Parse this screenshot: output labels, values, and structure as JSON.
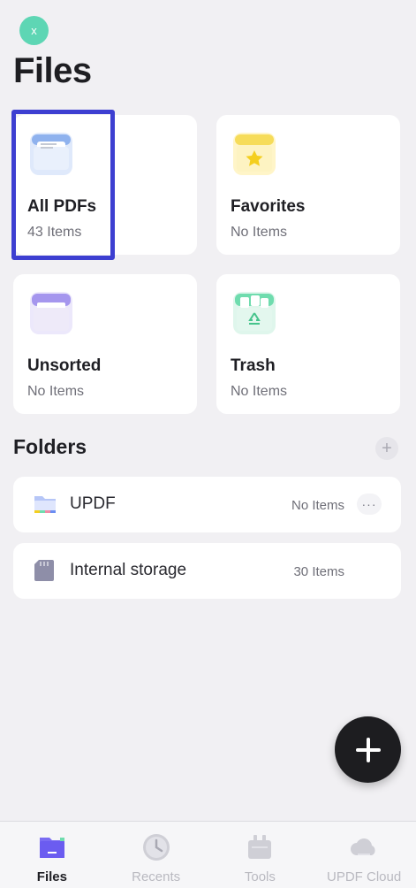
{
  "header": {
    "close_label": "x",
    "title": "Files"
  },
  "cards": [
    {
      "title": "All PDFs",
      "count": "43 Items",
      "icon": "pdf-stack-icon"
    },
    {
      "title": "Favorites",
      "count": "No Items",
      "icon": "star-folder-icon"
    },
    {
      "title": "Unsorted",
      "count": "No Items",
      "icon": "inbox-tray-icon"
    },
    {
      "title": "Trash",
      "count": "No Items",
      "icon": "recycle-bin-icon"
    }
  ],
  "folders": {
    "title": "Folders",
    "add_label": "+",
    "items": [
      {
        "name": "UPDF",
        "count": "No Items",
        "more_label": "···",
        "icon": "folder-icon"
      },
      {
        "name": "Internal storage",
        "count": "30 Items",
        "icon": "sd-card-icon"
      }
    ]
  },
  "fab": {
    "icon": "plus-icon"
  },
  "nav": [
    {
      "label": "Files",
      "icon": "files-icon",
      "active": true
    },
    {
      "label": "Recents",
      "icon": "clock-icon",
      "active": false
    },
    {
      "label": "Tools",
      "icon": "toolbox-icon",
      "active": false
    },
    {
      "label": "UPDF Cloud",
      "icon": "cloud-icon",
      "active": false
    }
  ],
  "colors": {
    "background": "#f1f0f3",
    "accent_highlight": "#3d3fd1",
    "close_button": "#5ed6b4",
    "fab": "#1d1d20",
    "active_nav": "#6b5cf0"
  }
}
